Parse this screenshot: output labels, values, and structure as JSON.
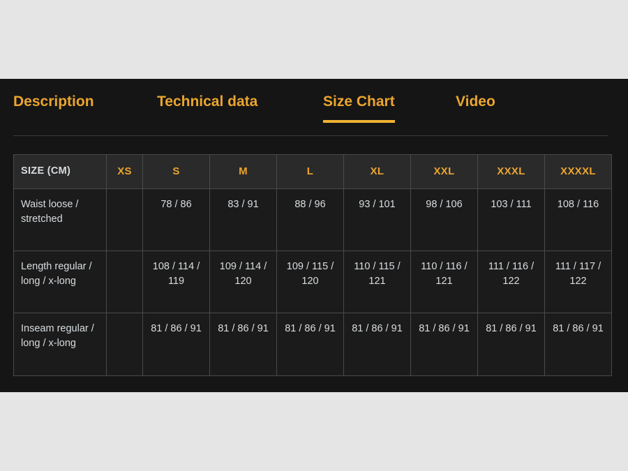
{
  "tabs": [
    {
      "id": "description",
      "label": "Description",
      "active": false
    },
    {
      "id": "technical-data",
      "label": "Technical data",
      "active": false
    },
    {
      "id": "size-chart",
      "label": "Size Chart",
      "active": true
    },
    {
      "id": "video",
      "label": "Video",
      "active": false
    }
  ],
  "colors": {
    "accent": "#eba52f",
    "accent_underline": "#f0b133",
    "panel_background": "#151515",
    "page_background": "#e5e5e5",
    "table_header_background": "#2a2a2a",
    "table_cell_background": "#1b1b1b",
    "table_border": "#4a4a4a",
    "text": "#d8dde0"
  },
  "size_chart": {
    "corner_label": "SIZE (CM)",
    "columns": [
      "XS",
      "S",
      "M",
      "L",
      "XL",
      "XXL",
      "XXXL",
      "XXXXL"
    ],
    "rows": [
      {
        "label": "Waist loose / stretched",
        "values": [
          "",
          "78 / 86",
          "83 / 91",
          "88 / 96",
          "93 / 101",
          "98 / 106",
          "103 / 111",
          "108 / 116"
        ]
      },
      {
        "label": "Length regular / long / x-long",
        "values": [
          "",
          "108 / 114 / 119",
          "109 / 114 / 120",
          "109 / 115 / 120",
          "110 / 115 / 121",
          "110 / 116 / 121",
          "111 / 116 / 122",
          "111 / 117 / 122"
        ]
      },
      {
        "label": "Inseam regular / long / x-long",
        "values": [
          "",
          "81 / 86 / 91",
          "81 / 86 / 91",
          "81 / 86 / 91",
          "81 / 86 / 91",
          "81 / 86 / 91",
          "81 / 86 / 91",
          "81 / 86 / 91"
        ]
      }
    ]
  }
}
